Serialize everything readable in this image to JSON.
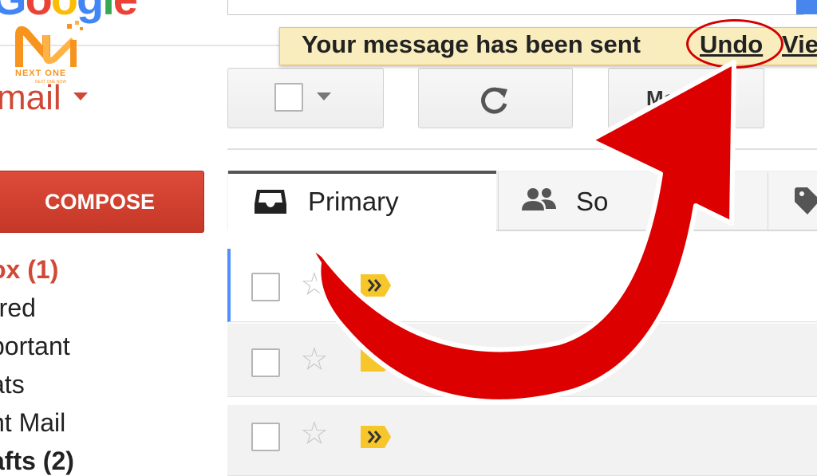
{
  "colors": {
    "gmail_red": "#d14836",
    "compose_red": "#dd4b39",
    "notify_bg": "#f9edbe",
    "arrow_red": "#dd0000",
    "primary_tab_border": "#555555",
    "unread_bar": "#4d90fe",
    "brand_orange": "#f7941d"
  },
  "brand": {
    "logo_icon": "next-one-logo",
    "name": "NEXT ONE",
    "tagline": "NEXT ONE NOW"
  },
  "header": {
    "logo_icon": "google-logo"
  },
  "app": {
    "label": "mail"
  },
  "notification": {
    "message": "Your message has been sent",
    "undo_label": "Undo",
    "view_label": "Vie"
  },
  "toolbar": {
    "more_label": "Mo"
  },
  "compose": {
    "label": "COMPOSE"
  },
  "folders": [
    {
      "label": "ox (1)"
    },
    {
      "label": "rred"
    },
    {
      "label": "portant"
    },
    {
      "label": "ats"
    },
    {
      "label": "nt Mail"
    },
    {
      "label": "afts (2)"
    }
  ],
  "tabs": [
    {
      "label": "Primary",
      "icon": "inbox-icon"
    },
    {
      "label": "So",
      "icon": "people-icon"
    },
    {
      "label": "",
      "icon": "tag-icon"
    }
  ],
  "rows": [
    {
      "unread": true
    },
    {
      "unread": false
    },
    {
      "unread": false
    }
  ]
}
